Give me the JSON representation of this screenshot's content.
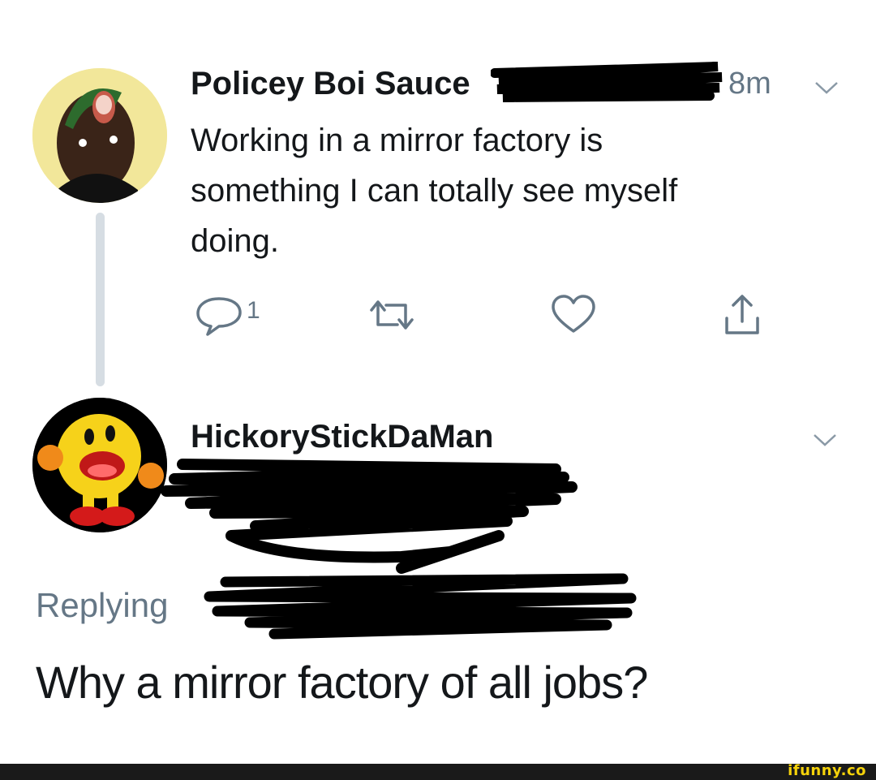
{
  "tweet1": {
    "author": "Policey Boi Sauce",
    "time": "8m",
    "text": "Working in a mirror factory is\nsomething I can totally see myself\ndoing.",
    "reply_count": "1",
    "icons": [
      "reply-icon",
      "retweet-icon",
      "like-icon",
      "share-icon",
      "chevron-down-icon"
    ]
  },
  "tweet2": {
    "author": "HickoryStickDaMan",
    "replying_label": "Replying",
    "text": "Why a mirror factory of all jobs?"
  },
  "footer": {
    "brand": "ifunny.co"
  },
  "colors": {
    "text": "#14171a",
    "muted": "#657786",
    "thread_line": "#d6dde3",
    "brand": "#f5d20a"
  }
}
